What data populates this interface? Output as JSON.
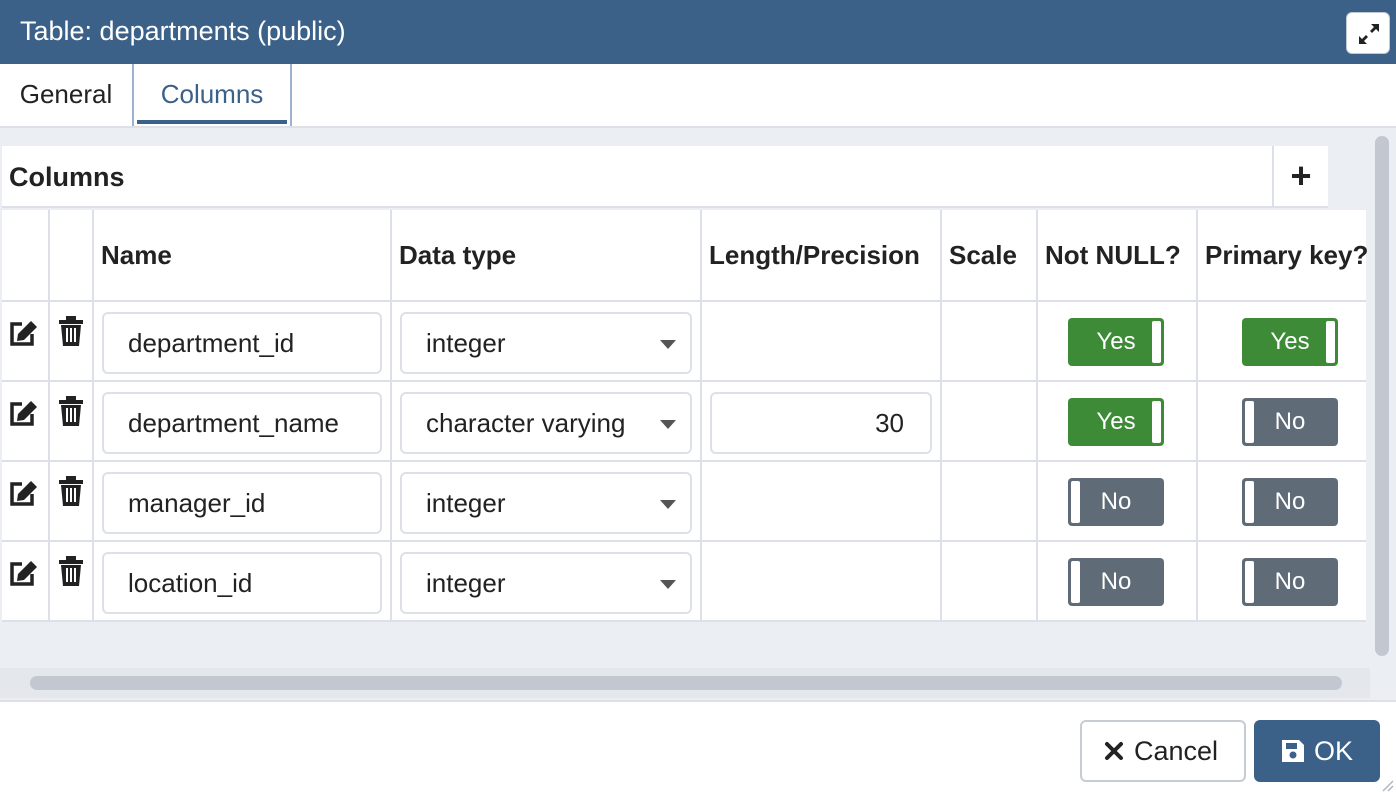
{
  "dialog": {
    "title": "Table: departments (public)"
  },
  "tabs": [
    {
      "label": "General",
      "active": false
    },
    {
      "label": "Columns",
      "active": true
    }
  ],
  "columns_panel": {
    "title": "Columns",
    "add_label": "+",
    "headers": {
      "name": "Name",
      "data_type": "Data type",
      "length": "Length/Precision",
      "scale": "Scale",
      "not_null": "Not NULL?",
      "primary_key": "Primary key?"
    },
    "rows": [
      {
        "name": "department_id",
        "data_type": "integer",
        "length": "",
        "scale": "",
        "not_null": "Yes",
        "primary_key": "Yes"
      },
      {
        "name": "department_name",
        "data_type": "character varying",
        "length": "30",
        "scale": "",
        "not_null": "Yes",
        "primary_key": "No"
      },
      {
        "name": "manager_id",
        "data_type": "integer",
        "length": "",
        "scale": "",
        "not_null": "No",
        "primary_key": "No"
      },
      {
        "name": "location_id",
        "data_type": "integer",
        "length": "",
        "scale": "",
        "not_null": "No",
        "primary_key": "No"
      }
    ]
  },
  "footer": {
    "cancel_label": "Cancel",
    "ok_label": "OK"
  },
  "colors": {
    "header": "#3c6189",
    "toggle_yes": "#3d8b37",
    "toggle_no": "#5f6b76"
  },
  "icons": [
    "maximize-icon",
    "edit-icon",
    "trash-icon",
    "close-icon",
    "save-icon",
    "dropdown-arrow-icon"
  ]
}
